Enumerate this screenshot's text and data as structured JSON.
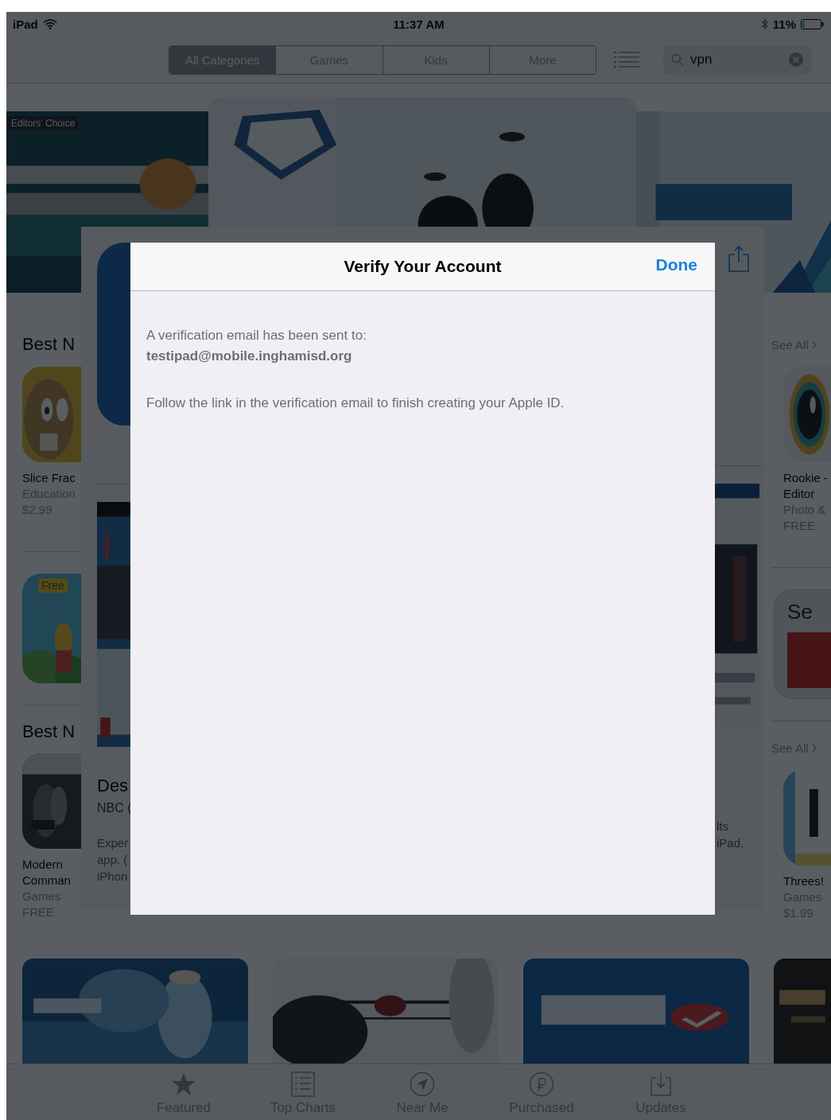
{
  "status_bar": {
    "device": "iPad",
    "time": "11:37 AM",
    "battery": "11%"
  },
  "nav": {
    "segments": [
      {
        "label": "All Categories",
        "selected": true
      },
      {
        "label": "Games",
        "selected": false
      },
      {
        "label": "Kids",
        "selected": false
      },
      {
        "label": "More",
        "selected": false
      }
    ],
    "search": {
      "value": "vpn"
    }
  },
  "banners": {
    "badge": "Editors' Choice"
  },
  "left_column": {
    "sections": [
      {
        "title": "Best N",
        "app": {
          "name": "Slice Frac",
          "category": "Education",
          "price": "$2.99"
        }
      },
      {
        "title": "Best N",
        "app": {
          "name": "Modern Comman",
          "category": "Games",
          "price": "FREE"
        }
      }
    ],
    "free_badge": "Free"
  },
  "right_column": {
    "sections": [
      {
        "link": "See All",
        "app": {
          "name": "Rookie - Editor",
          "category": "Photo &",
          "price": "FREE"
        }
      },
      {
        "link": "See All",
        "app": {
          "name": "Threes!",
          "category": "Games",
          "price": "$1.99"
        }
      }
    ],
    "card_text": "Se"
  },
  "app_sheet": {
    "description_title": "Des",
    "developer": "NBC (",
    "description_left": [
      "Exper",
      "app. (",
      "iPhon"
    ],
    "description_right": [
      "lts",
      "iPad,"
    ]
  },
  "modal": {
    "title": "Verify Your Account",
    "done": "Done",
    "message": "A verification email has been sent to:",
    "email": "testipad@mobile.inghamisd.org",
    "instructions": "Follow the link in the verification email to finish creating your Apple ID."
  },
  "tab_bar": [
    {
      "label": "Featured",
      "kind": "star"
    },
    {
      "label": "Top Charts",
      "kind": "list"
    },
    {
      "label": "Near Me",
      "kind": "location"
    },
    {
      "label": "Purchased",
      "kind": "purchased"
    },
    {
      "label": "Updates",
      "kind": "updates"
    }
  ]
}
